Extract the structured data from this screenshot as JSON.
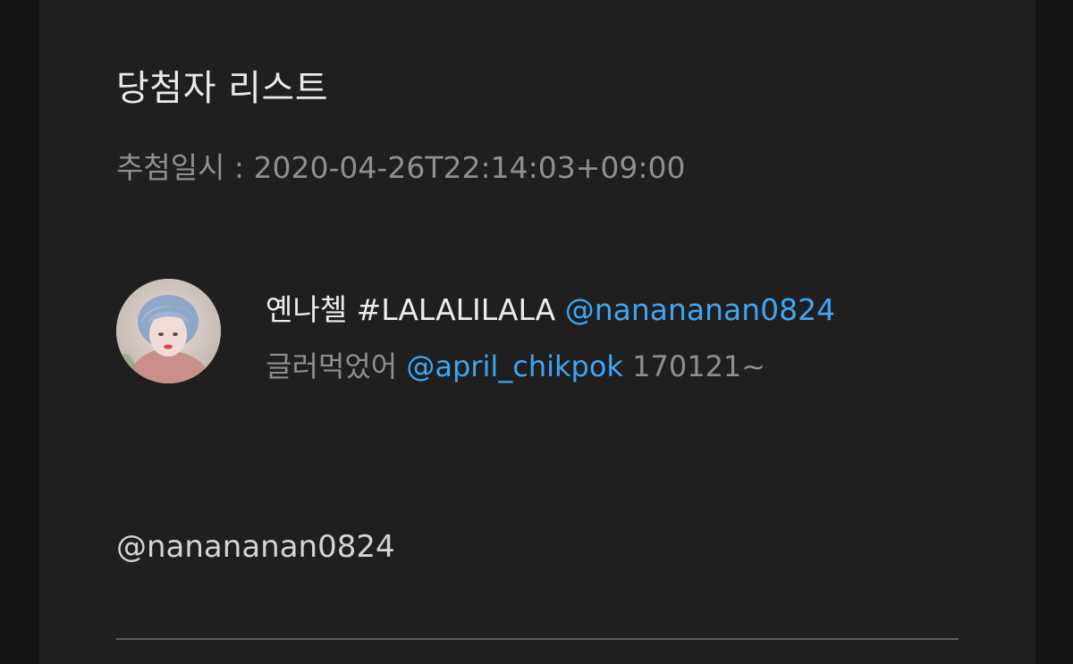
{
  "winner_list": {
    "title": "당첨자 리스트",
    "draw_time": "추첨일시 : 2020-04-26T22:14:03+09:00"
  },
  "winner": {
    "avatar_icon": "profile-photo",
    "name": "옌나첼 #LALALILALA",
    "name_handle": "@nanananan0824",
    "bio_prefix": "글러먹었어",
    "bio_handle": "@april_chikpok",
    "bio_suffix": "170121~",
    "handle": "@nanananan0824"
  },
  "colors": {
    "background": "#1f1f1f",
    "link": "#3ea6f3",
    "secondary_text": "#8f8f8f"
  }
}
